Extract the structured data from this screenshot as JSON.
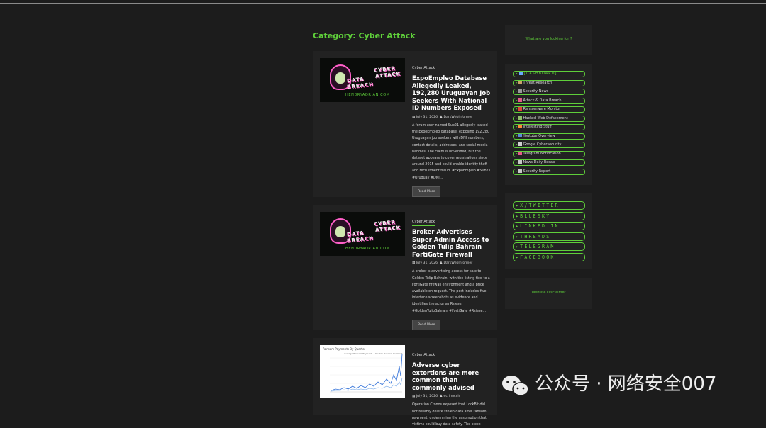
{
  "page": {
    "category_title": "Category: Cyber Attack"
  },
  "posts": [
    {
      "tag": "Cyber Attack",
      "title": "ExpoEmpleo Database Allegedly Leaked, 192,280 Uruguayan Job Seekers With National ID Numbers Exposed",
      "date": "July 31, 2026",
      "author": "DarkWebInformer",
      "excerpt": "A forum user named Sub21 allegedly leaked the ExpoEmpleo database, exposing 192,280 Uruguayan job seekers with DNI numbers, contact details, addresses, and social media handles. The claim is unverified, but the dataset appears to cover registrations since around 2015 and could enable identity theft and recruitment fraud. #ExpoEmpleo #Sub21 #Uruguay #DNI…",
      "read_more": "Read More",
      "image": {
        "line1": "CYBER",
        "line2": "ATTACK",
        "line3": "DATA",
        "line4": "BREACH",
        "site": "HENDRYADRIAN.COM"
      }
    },
    {
      "tag": "Cyber Attack",
      "title": "Broker Advertises Super Admin Access to Golden Tulip Bahrain FortiGate Firewall",
      "date": "July 31, 2026",
      "author": "DarkWebInformer",
      "excerpt": "A broker is advertising access for sale to Golden Tulip Bahrain, with the listing tied to a FortiGate firewall environment and a price available on request. The post includes five interface screenshots as evidence and identifies the actor as Rsiese. #GoldenTulipBahrain #FortiGate #Rsiese…",
      "read_more": "Read More",
      "image": {
        "line1": "CYBER",
        "line2": "ATTACK",
        "line3": "DATA",
        "line4": "BREACH",
        "site": "HENDRYADRIAN.COM"
      }
    },
    {
      "tag": "Cyber Attack",
      "title": "Adverse cyber extortions are more common than commonly advised",
      "date": "July 31, 2026",
      "author": "ecrime.ch",
      "excerpt": "Operation Cronos exposed that LockBit did not reliably delete stolen data after ransom payment, undermining the assumption that victims could buy data safety. The piece",
      "image": {
        "chart_title": "Ransom Payments By Quarter",
        "legend": "— Average Ransom Payment   — Median Ransom Payment"
      }
    }
  ],
  "sidebar": {
    "search_label": "What are you looking for ?",
    "menu": [
      {
        "label": "[DASHBOARD]",
        "icon": "dashboard-icon",
        "color": "#6aa8ff"
      },
      {
        "label": "Threat Research",
        "icon": "flask-icon",
        "color": "#c9a36a"
      },
      {
        "label": "Security News",
        "icon": "news-icon",
        "color": "#9a9a9a"
      },
      {
        "label": "Attack & Data Breach",
        "icon": "skull-icon",
        "color": "#e45b8a"
      },
      {
        "label": "Ransomware Monitor",
        "icon": "target-icon",
        "color": "#e0453a"
      },
      {
        "label": "Hacked Web Defacement",
        "icon": "bug-icon",
        "color": "#8fbf6a"
      },
      {
        "label": "Interesting Stuff",
        "icon": "fire-icon",
        "color": "#ff8a3a"
      },
      {
        "label": "Youtube Overview",
        "icon": "tv-icon",
        "color": "#5a8ad8"
      },
      {
        "label": "Google Cybersecurity",
        "icon": "search-icon",
        "color": "#d0d0d0"
      },
      {
        "label": "Telegram Notification",
        "icon": "send-icon",
        "color": "#e45b8a"
      },
      {
        "label": "News Daily Recap",
        "icon": "newspaper-icon",
        "color": "#c8c8c8"
      },
      {
        "label": "Security Report",
        "icon": "document-icon",
        "color": "#c8c8c8"
      }
    ],
    "social": [
      "X/TWITTER",
      "BLUESKY",
      "LINKED.IN",
      "THREADS",
      "TELEGRAM",
      "FACEBOOK"
    ],
    "disclaimer": "Website Disclaimer"
  },
  "watermark": {
    "text": "公众号 · 网络安全007"
  },
  "colors": {
    "accent": "#5fcf3a",
    "background": "#1c1c1c",
    "card": "#222222"
  }
}
